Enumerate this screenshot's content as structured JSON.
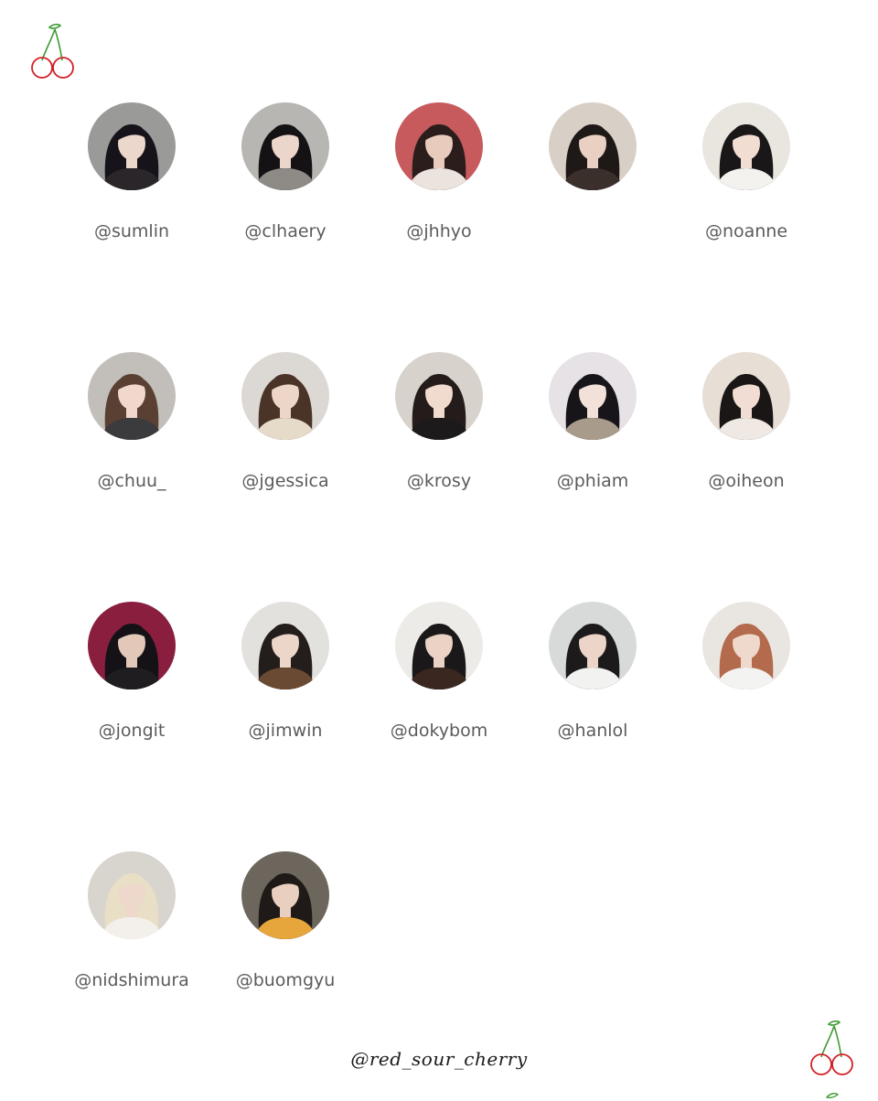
{
  "decorations": {
    "cherry_icon": "cherry-icon",
    "cherry_green": "#3e9a33",
    "cherry_red": "#d21f26"
  },
  "credit": "@red_sour_cherry",
  "profiles": [
    {
      "handle": "@sumlin",
      "bg": "#9a9a98",
      "hair": "#16141a",
      "skin": "#ecd7cc",
      "cloth": "#2a2629"
    },
    {
      "handle": "@clhaery",
      "bg": "#b8b6b2",
      "hair": "#141214",
      "skin": "#ecd6cb",
      "cloth": "#8e8a86"
    },
    {
      "handle": "@jhhyo",
      "bg": "#c75a5d",
      "hair": "#2a1d1b",
      "skin": "#e8cbbd",
      "cloth": "#ebe3dd"
    },
    {
      "handle": "",
      "bg": "#d8cfc6",
      "hair": "#1e1917",
      "skin": "#e9d0c2",
      "cloth": "#3a2f2b"
    },
    {
      "handle": "@noanne",
      "bg": "#e9e6e0",
      "hair": "#1a1718",
      "skin": "#f2ddd3",
      "cloth": "#f4f2ef"
    },
    {
      "handle": "@chuu_",
      "bg": "#c2bfbb",
      "hair": "#5a4033",
      "skin": "#f0d8cd",
      "cloth": "#3b3a3c"
    },
    {
      "handle": "@jgessica",
      "bg": "#dcd8d3",
      "hair": "#4a3427",
      "skin": "#edd6c8",
      "cloth": "#e6dac8"
    },
    {
      "handle": "@krosy",
      "bg": "#d8d2cc",
      "hair": "#241c1a",
      "skin": "#f1dbcf",
      "cloth": "#1c1a1b"
    },
    {
      "handle": "@phiam",
      "bg": "#e6e2e5",
      "hair": "#17151a",
      "skin": "#f2e1d9",
      "cloth": "#a89b8b"
    },
    {
      "handle": "@oiheon",
      "bg": "#e7ded6",
      "hair": "#1b1616",
      "skin": "#f2ddd4",
      "cloth": "#f0e9e3"
    },
    {
      "handle": "@jongit",
      "bg": "#8a1e3f",
      "hair": "#141216",
      "skin": "#e3c8ba",
      "cloth": "#1f1d1f"
    },
    {
      "handle": "@jimwin",
      "bg": "#e2e1de",
      "hair": "#231d1c",
      "skin": "#ecd6c9",
      "cloth": "#6a4a33"
    },
    {
      "handle": "@dokybom",
      "bg": "#ecebe7",
      "hair": "#1b1819",
      "skin": "#ead2c5",
      "cloth": "#3a2720"
    },
    {
      "handle": "@hanlol",
      "bg": "#d8dad9",
      "hair": "#1c1a1b",
      "skin": "#ecd5c8",
      "cloth": "#f2f2f0"
    },
    {
      "handle": "",
      "bg": "#e9e6e2",
      "hair": "#b46a4c",
      "skin": "#efd8cc",
      "cloth": "#f3f3f1"
    },
    {
      "handle": "@nidshimura",
      "bg": "#d8d4ce",
      "hair": "#e9dfc6",
      "skin": "#edd8cb",
      "cloth": "#f3f0ec"
    },
    {
      "handle": "@buomgyu",
      "bg": "#6d665c",
      "hair": "#1f1a18",
      "skin": "#e8cfbf",
      "cloth": "#e7a63c"
    }
  ]
}
